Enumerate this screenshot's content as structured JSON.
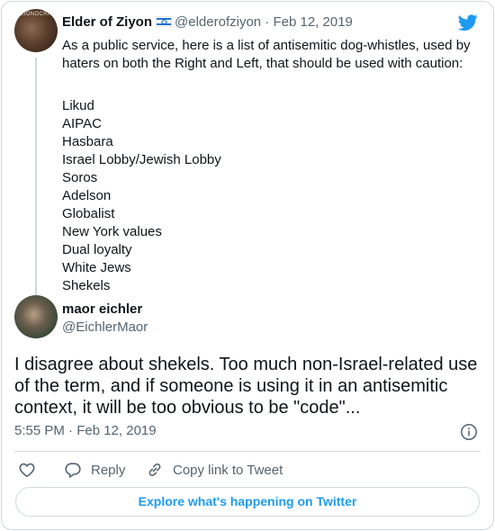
{
  "parent_tweet": {
    "avatar_text": "ZIONOCRA",
    "name": "Elder of Ziyon",
    "flag": "israel-flag",
    "handle": "@elderofziyon",
    "separator": "·",
    "date": "Feb 12, 2019",
    "body": "As a public service, here is a list of antisemitic dog-whistles, used by haters on both the Right and Left, that should be used with caution:",
    "list": [
      "Likud",
      "AIPAC",
      "Hasbara",
      "Israel Lobby/Jewish Lobby",
      "Soros",
      "Adelson",
      "Globalist",
      "New York values",
      "Dual loyalty",
      "White Jews",
      "Shekels"
    ]
  },
  "reply_tweet": {
    "name": "maor eichler",
    "handle": "@EichlerMaor",
    "text": "I disagree about shekels. Too much non-Israel-related use of the term, and if someone is using it in an antisemitic context, it will be too obvious to be \"code\"...",
    "timestamp": "5:55 PM · Feb 12, 2019"
  },
  "actions": {
    "like_icon": "heart-icon",
    "reply_label": "Reply",
    "copy_label": "Copy link to Tweet"
  },
  "explore_label": "Explore what's happening on Twitter",
  "colors": {
    "accent": "#1d9bf0",
    "text": "#0f1419",
    "secondary": "#536471",
    "border": "#cfd9de"
  }
}
